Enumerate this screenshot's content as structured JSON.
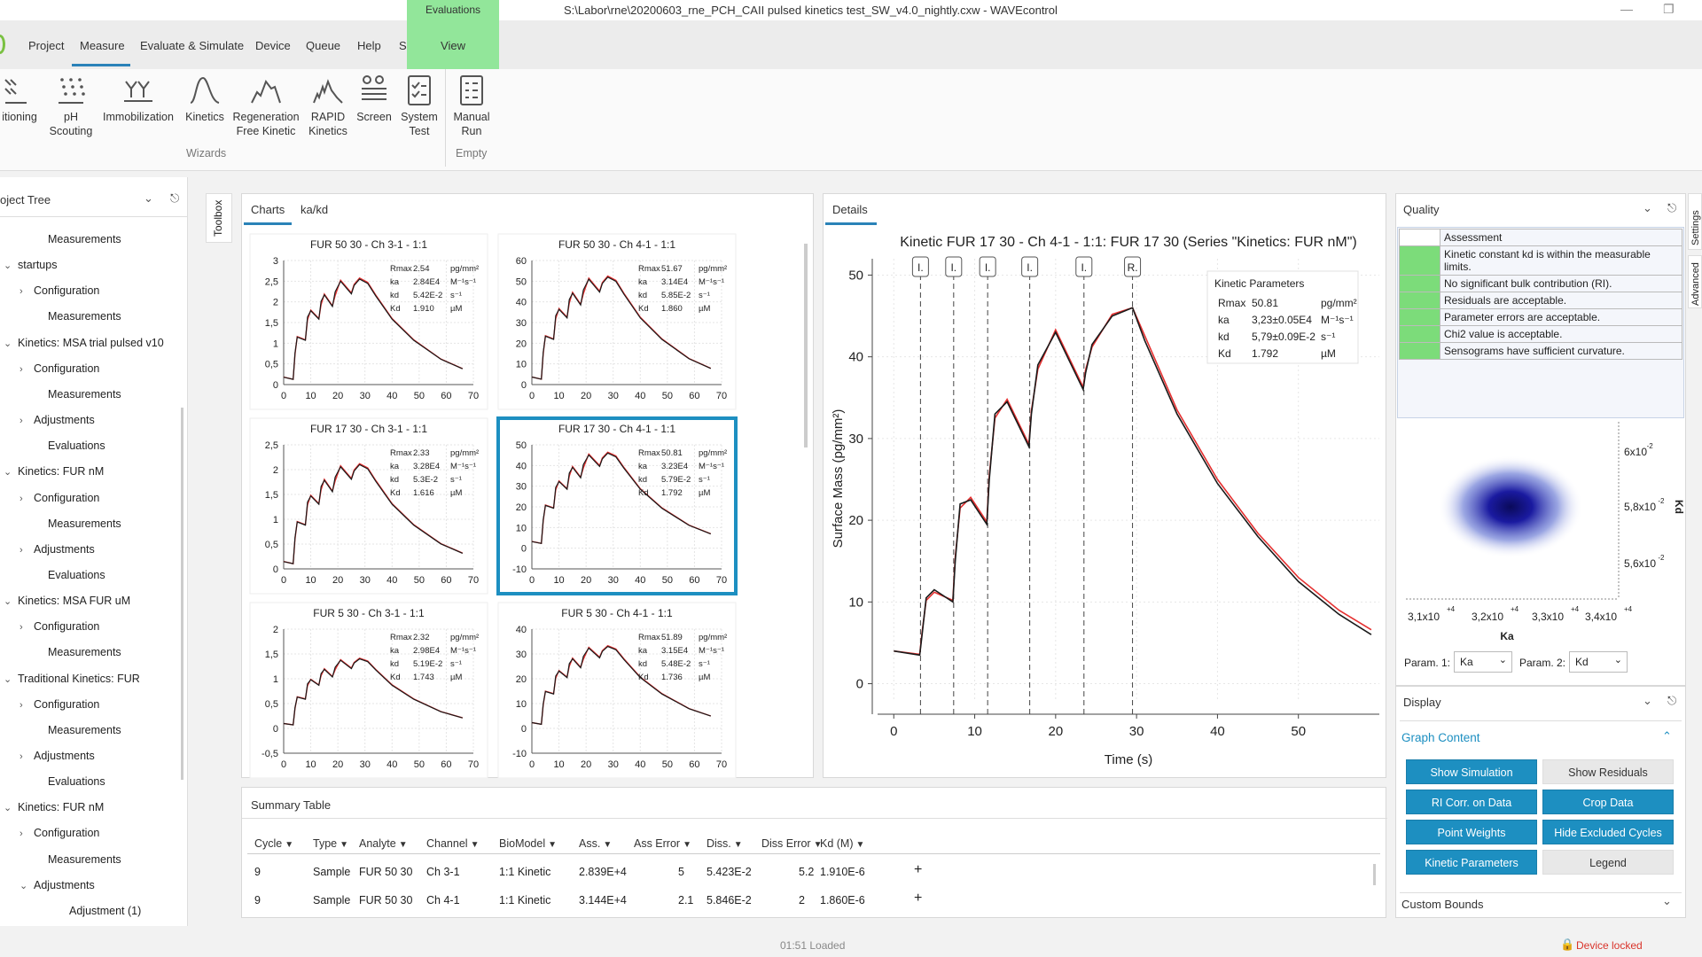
{
  "window": {
    "title": "S:\\Labor\\rne\\20200603_rne_PCH_CAII pulsed kinetics test_SW_v4.0_nightly.cxw - WAVEcontrol"
  },
  "menu": {
    "items": [
      "Project",
      "Measure",
      "Evaluate & Simulate",
      "Device",
      "Queue",
      "Help",
      "Series"
    ],
    "context_group": "Evaluations",
    "context_tab": "View",
    "active": "Measure"
  },
  "ribbon": {
    "buttons": [
      {
        "label": "itioning",
        "icon": "conditioning-icon"
      },
      {
        "label": "pH\nScouting",
        "icon": "ph-scouting-icon"
      },
      {
        "label": "Immobilization",
        "icon": "immobilization-icon"
      },
      {
        "label": "Kinetics",
        "icon": "kinetics-icon"
      },
      {
        "label": "Regeneration\nFree Kinetic",
        "icon": "regeneration-icon"
      },
      {
        "label": "RAPID\nKinetics",
        "icon": "rapid-kinetics-icon"
      },
      {
        "label": "Screen",
        "icon": "screen-icon"
      },
      {
        "label": "System\nTest",
        "icon": "system-test-icon"
      },
      {
        "label": "Manual\nRun",
        "icon": "manual-run-icon"
      }
    ],
    "group_wizards": "Wizards",
    "group_empty": "Empty"
  },
  "tree": {
    "title": "oject Tree",
    "rows": [
      {
        "label": "Measurements",
        "level": 2,
        "arrow": ""
      },
      {
        "label": "startups",
        "level": 1,
        "arrow": "v"
      },
      {
        "label": "Configuration",
        "level": 2,
        "arrow": ">"
      },
      {
        "label": "Measurements",
        "level": 2,
        "arrow": ""
      },
      {
        "label": "Kinetics: MSA trial pulsed v10",
        "level": 1,
        "arrow": "v"
      },
      {
        "label": "Configuration",
        "level": 2,
        "arrow": ">"
      },
      {
        "label": "Measurements",
        "level": 2,
        "arrow": ""
      },
      {
        "label": "Adjustments",
        "level": 2,
        "arrow": ">"
      },
      {
        "label": "Evaluations",
        "level": 2,
        "arrow": ""
      },
      {
        "label": "Kinetics: FUR nM",
        "level": 1,
        "arrow": "v"
      },
      {
        "label": "Configuration",
        "level": 2,
        "arrow": ">"
      },
      {
        "label": "Measurements",
        "level": 2,
        "arrow": ""
      },
      {
        "label": "Adjustments",
        "level": 2,
        "arrow": ">"
      },
      {
        "label": "Evaluations",
        "level": 2,
        "arrow": ""
      },
      {
        "label": "Kinetics: MSA FUR uM",
        "level": 1,
        "arrow": "v"
      },
      {
        "label": "Configuration",
        "level": 2,
        "arrow": ">"
      },
      {
        "label": "Measurements",
        "level": 2,
        "arrow": ""
      },
      {
        "label": "Traditional Kinetics: FUR",
        "level": 1,
        "arrow": "v"
      },
      {
        "label": "Configuration",
        "level": 2,
        "arrow": ">"
      },
      {
        "label": "Measurements",
        "level": 2,
        "arrow": ""
      },
      {
        "label": "Adjustments",
        "level": 2,
        "arrow": ">"
      },
      {
        "label": "Evaluations",
        "level": 2,
        "arrow": ""
      },
      {
        "label": "Kinetics: FUR nM",
        "level": 1,
        "arrow": "v"
      },
      {
        "label": "Configuration",
        "level": 2,
        "arrow": ">"
      },
      {
        "label": "Measurements",
        "level": 2,
        "arrow": ""
      },
      {
        "label": "Adjustments",
        "level": 2,
        "arrow": "v"
      },
      {
        "label": "Adjustment (1)",
        "level": 3,
        "arrow": ""
      }
    ]
  },
  "toolbox": {
    "label": "Toolbox"
  },
  "charts_panel": {
    "tabs": [
      "Charts",
      "ka/kd"
    ]
  },
  "details_panel": {
    "tab": "Details"
  },
  "chart_data": [
    {
      "type": "line",
      "title": "Kinetic FUR 17 30 - Ch 4-1 - 1:1: FUR 17 30 (Series \"Kinetics: FUR nM\")",
      "xlabel": "Time (s)",
      "ylabel": "Surface Mass (pg/mm²)",
      "xlim": [
        -2,
        60
      ],
      "ylim": [
        -2,
        52
      ],
      "xticks": [
        0,
        10,
        20,
        30,
        40,
        50
      ],
      "yticks": [
        0,
        10,
        20,
        30,
        40,
        50
      ],
      "injection_markers": [
        {
          "x": 3.3,
          "label": "I."
        },
        {
          "x": 7.4,
          "label": "I."
        },
        {
          "x": 11.6,
          "label": "I."
        },
        {
          "x": 16.8,
          "label": "I."
        },
        {
          "x": 23.5,
          "label": "I."
        },
        {
          "x": 29.5,
          "label": "R."
        }
      ],
      "series": [
        {
          "role": "measured",
          "color": "#1a1a1a",
          "x": [
            0,
            3.2,
            3.5,
            4,
            5,
            7.3,
            7.6,
            8.2,
            9.5,
            11.5,
            11.8,
            12.5,
            14,
            16.7,
            17,
            17.8,
            20,
            23.4,
            23.7,
            24.5,
            27,
            29.5,
            31,
            35,
            40,
            45,
            50,
            55,
            59
          ],
          "y": [
            4,
            3.5,
            6,
            10.5,
            11.5,
            10,
            15,
            22,
            22.5,
            19.5,
            25,
            33,
            34.5,
            29,
            33,
            39,
            43,
            36,
            38,
            41.5,
            45,
            46,
            42,
            33,
            24.5,
            18,
            12.5,
            8.5,
            6
          ]
        },
        {
          "role": "fit",
          "color": "#e53030",
          "x": [
            0,
            3.2,
            3.5,
            4,
            5,
            7.3,
            7.6,
            8.2,
            9.5,
            11.5,
            11.8,
            12.5,
            14,
            16.7,
            17,
            17.8,
            20,
            23.4,
            23.7,
            24.5,
            27,
            29.5,
            31,
            35,
            40,
            45,
            50,
            55,
            59
          ],
          "y": [
            4,
            3.6,
            6.3,
            10.2,
            11.2,
            10.2,
            15.5,
            21.5,
            22.8,
            19.8,
            25.5,
            32.5,
            34.8,
            29.3,
            33.4,
            38.5,
            43.3,
            36.3,
            38.4,
            41.2,
            45.2,
            46,
            42.6,
            33.5,
            25,
            18.4,
            13,
            9,
            6.6
          ]
        }
      ],
      "annotation": {
        "title": "Kinetic Parameters",
        "rows": [
          {
            "name": "Rmax",
            "value": "50.81",
            "unit": "pg/mm²"
          },
          {
            "name": "ka",
            "value": "3,23±0.05E4",
            "unit": "M⁻¹s⁻¹"
          },
          {
            "name": "kd",
            "value": "5,79±0.09E-2",
            "unit": "s⁻¹"
          },
          {
            "name": "Kd",
            "value": "1.792",
            "unit": "µM"
          }
        ]
      }
    },
    {
      "type": "line",
      "title": "FUR 50 30 - Ch 3-1 - 1:1",
      "xlim": [
        0,
        70
      ],
      "ylim": [
        0,
        3
      ],
      "xticks": [
        0,
        10,
        20,
        30,
        40,
        50,
        60,
        70
      ],
      "yticks": [
        0,
        0.5,
        1,
        1.5,
        2,
        2.5,
        3
      ],
      "ytick_labels": [
        "0",
        "0,5",
        "1",
        "1,5",
        "2",
        "2,5",
        "3"
      ],
      "peak": 2.55,
      "trough_scale": 0.6,
      "params": [
        [
          "Rmax",
          "2.54",
          "pg/mm²"
        ],
        [
          "ka",
          "2.84E4",
          "M⁻¹s⁻¹"
        ],
        [
          "kd",
          "5.42E-2",
          "s⁻¹"
        ],
        [
          "Kd",
          "1.910",
          "µM"
        ]
      ]
    },
    {
      "type": "line",
      "title": "FUR 50 30 - Ch 4-1 - 1:1",
      "xlim": [
        0,
        70
      ],
      "ylim": [
        0,
        60
      ],
      "xticks": [
        0,
        10,
        20,
        30,
        40,
        50,
        60,
        70
      ],
      "yticks": [
        0,
        10,
        20,
        30,
        40,
        50,
        60
      ],
      "ytick_labels": [
        "0",
        "10",
        "20",
        "30",
        "40",
        "50",
        "60"
      ],
      "peak": 52,
      "trough_scale": 0.6,
      "params": [
        [
          "Rmax",
          "51.67",
          "pg/mm²"
        ],
        [
          "ka",
          "3.14E4",
          "M⁻¹s⁻¹"
        ],
        [
          "kd",
          "5.85E-2",
          "s⁻¹"
        ],
        [
          "Kd",
          "1.860",
          "µM"
        ]
      ]
    },
    {
      "type": "line",
      "title": "FUR 17 30 - Ch 3-1 - 1:1",
      "xlim": [
        0,
        70
      ],
      "ylim": [
        0,
        2.5
      ],
      "xticks": [
        0,
        10,
        20,
        30,
        40,
        50,
        60,
        70
      ],
      "yticks": [
        0,
        0.5,
        1,
        1.5,
        2,
        2.5
      ],
      "ytick_labels": [
        "0",
        "0,5",
        "1",
        "1,5",
        "2",
        "2,5"
      ],
      "peak": 2.1,
      "trough_scale": 0.6,
      "params": [
        [
          "Rmax",
          "2.33",
          "pg/mm²"
        ],
        [
          "ka",
          "3.28E4",
          "M⁻¹s⁻¹"
        ],
        [
          "kd",
          "5.3E-2",
          "s⁻¹"
        ],
        [
          "Kd",
          "1.616",
          "µM"
        ]
      ]
    },
    {
      "type": "line",
      "title": "FUR 17 30 - Ch 4-1 - 1:1",
      "xlim": [
        0,
        70
      ],
      "ylim": [
        -10,
        50
      ],
      "xticks": [
        0,
        10,
        20,
        30,
        40,
        50,
        60,
        70
      ],
      "yticks": [
        -10,
        0,
        10,
        20,
        30,
        40,
        50
      ],
      "ytick_labels": [
        "-10",
        "0",
        "10",
        "20",
        "30",
        "40",
        "50"
      ],
      "peak": 46,
      "trough_scale": 0.6,
      "selected": true,
      "params": [
        [
          "Rmax",
          "50.81",
          "pg/mm²"
        ],
        [
          "ka",
          "3.23E4",
          "M⁻¹s⁻¹"
        ],
        [
          "kd",
          "5.79E-2",
          "s⁻¹"
        ],
        [
          "Kd",
          "1.792",
          "µM"
        ]
      ]
    },
    {
      "type": "line",
      "title": "FUR 5 30 - Ch 3-1 - 1:1",
      "xlim": [
        0,
        70
      ],
      "ylim": [
        -0.5,
        2
      ],
      "xticks": [
        0,
        10,
        20,
        30,
        40,
        50,
        60,
        70
      ],
      "yticks": [
        -0.5,
        0,
        0.5,
        1,
        1.5,
        2
      ],
      "ytick_labels": [
        "-0,5",
        "0",
        "0,5",
        "1",
        "1,5",
        "2"
      ],
      "peak": 1.4,
      "trough_scale": 0.6,
      "params": [
        [
          "Rmax",
          "2.32",
          "pg/mm²"
        ],
        [
          "ka",
          "2.98E4",
          "M⁻¹s⁻¹"
        ],
        [
          "kd",
          "5.19E-2",
          "s⁻¹"
        ],
        [
          "Kd",
          "1.743",
          "µM"
        ]
      ]
    },
    {
      "type": "line",
      "title": "FUR 5 30 - Ch 4-1 - 1:1",
      "xlim": [
        0,
        70
      ],
      "ylim": [
        -10,
        40
      ],
      "xticks": [
        0,
        10,
        20,
        30,
        40,
        50,
        60,
        70
      ],
      "yticks": [
        -10,
        0,
        10,
        20,
        30,
        40
      ],
      "ytick_labels": [
        "-10",
        "0",
        "10",
        "20",
        "30",
        "40"
      ],
      "peak": 33,
      "trough_scale": 0.6,
      "params": [
        [
          "Rmax",
          "51.89",
          "pg/mm²"
        ],
        [
          "ka",
          "3.15E4",
          "M⁻¹s⁻¹"
        ],
        [
          "kd",
          "5.48E-2",
          "s⁻¹"
        ],
        [
          "Kd",
          "1.736",
          "µM"
        ]
      ]
    },
    {
      "type": "heatmap",
      "xlabel": "Ka",
      "ylabel": "Kd",
      "x_tick_labels": [
        "3,1x10",
        "3,2x10",
        "3,3x10",
        "3,4x10"
      ],
      "x_tick_exp": "+4",
      "y_tick_labels": [
        "6x10",
        "5,8x10",
        "5,6x10"
      ],
      "y_tick_exp": "-2",
      "center_color": "#0a0a5a"
    }
  ],
  "quality": {
    "title": "Quality",
    "header": "Assessment",
    "rows": [
      "Kinetic constant kd is within the measurable limits.",
      "No significant bulk contribution (RI).",
      "Residuals are acceptable.",
      "Parameter errors are acceptable.",
      "Chi2 value is acceptable.",
      "Sensograms have sufficient curvature."
    ],
    "pass_color": "#7cdc7a",
    "param1_label": "Param. 1:",
    "param1_value": "Ka",
    "param2_label": "Param. 2:",
    "param2_value": "Kd"
  },
  "display": {
    "title": "Display",
    "section": "Graph Content",
    "buttons": [
      {
        "label": "Show Simulation",
        "active": true
      },
      {
        "label": "Show Residuals",
        "active": false
      },
      {
        "label": "RI Corr. on Data",
        "active": true
      },
      {
        "label": "Crop Data",
        "active": true
      },
      {
        "label": "Point Weights",
        "active": true
      },
      {
        "label": "Hide Excluded Cycles",
        "active": true
      },
      {
        "label": "Kinetic Parameters",
        "active": true
      },
      {
        "label": "Legend",
        "active": false
      }
    ],
    "custom_bounds": "Custom Bounds",
    "accent": "#1d8fc1"
  },
  "summary": {
    "tab": "Summary Table",
    "columns": [
      "Cycle",
      "Type",
      "Analyte",
      "Channel",
      "BioModel",
      "Ass.",
      "Ass Error",
      "Diss.",
      "Diss Error",
      "Kd (M)"
    ],
    "rows": [
      [
        "9",
        "Sample",
        "FUR 50 30",
        "Ch 3-1",
        "1:1 Kinetic",
        "2.839E+4",
        "5",
        "5.423E-2",
        "5.2",
        "1.910E-6"
      ],
      [
        "9",
        "Sample",
        "FUR 50 30",
        "Ch 4-1",
        "1:1 Kinetic",
        "3.144E+4",
        "2.1",
        "5.846E-2",
        "2",
        "1.860E-6"
      ]
    ]
  },
  "side_tabs": [
    "Settings",
    "Advanced"
  ],
  "status": {
    "center": "01:51 Loaded",
    "right": "Device locked",
    "right_color": "#d9332a"
  }
}
